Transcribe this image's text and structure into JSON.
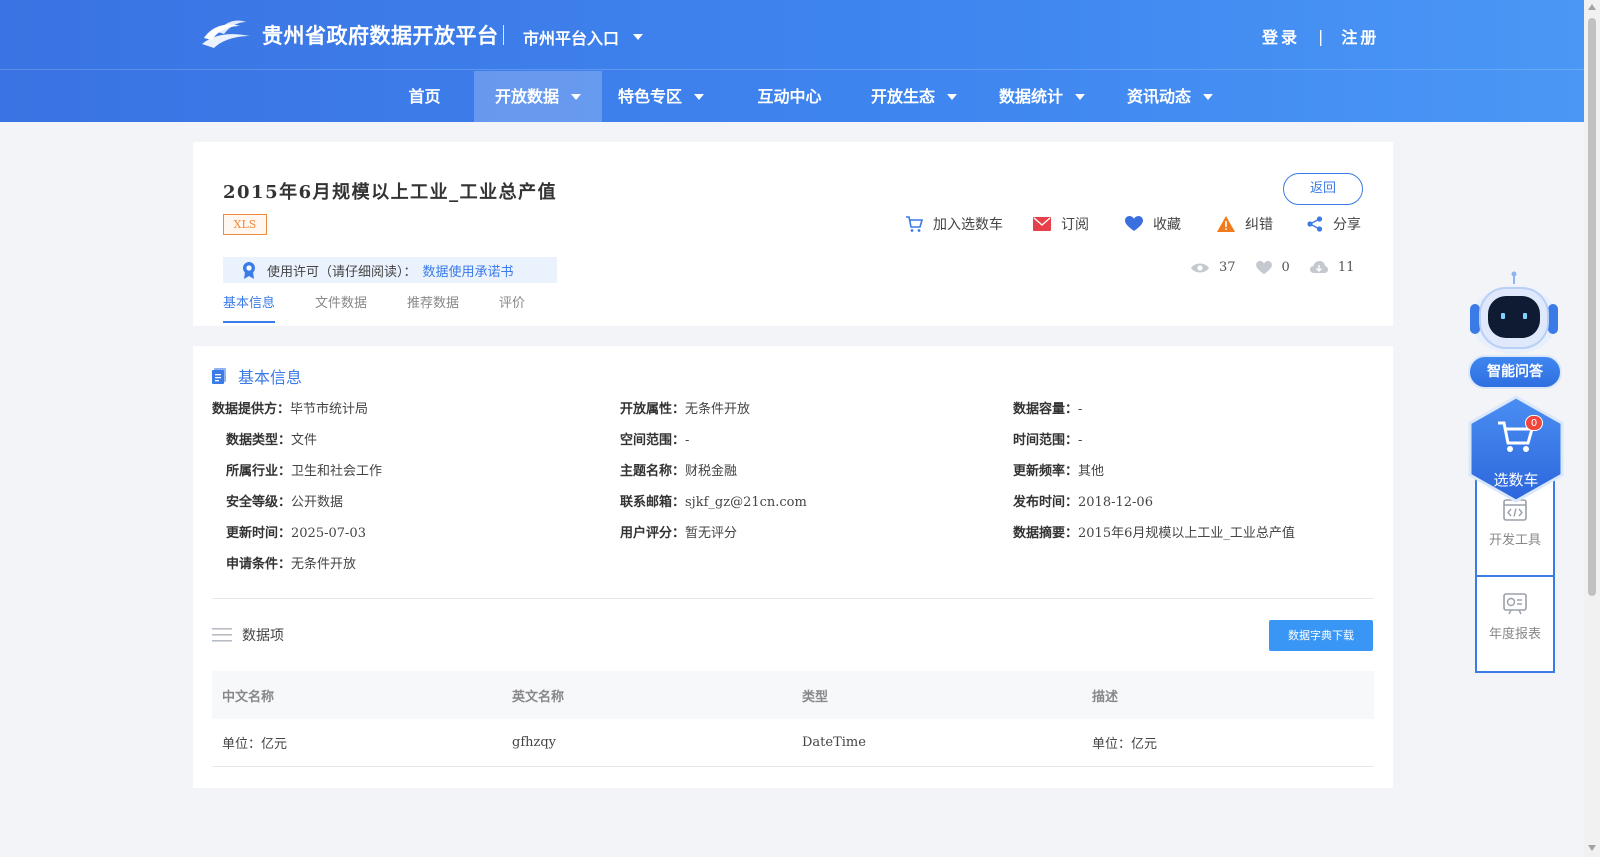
{
  "header": {
    "site_title": "贵州省政府数据开放平台",
    "city_entry": "市州平台入口",
    "login": "登录",
    "auth_sep": "|",
    "register": "注册"
  },
  "nav": {
    "items": [
      {
        "label": "首页",
        "has_dropdown": false,
        "active": false
      },
      {
        "label": "开放数据",
        "has_dropdown": true,
        "active": true
      },
      {
        "label": "特色专区",
        "has_dropdown": true,
        "active": false
      },
      {
        "label": "互动中心",
        "has_dropdown": false,
        "active": false
      },
      {
        "label": "开放生态",
        "has_dropdown": true,
        "active": false
      },
      {
        "label": "数据统计",
        "has_dropdown": true,
        "active": false
      },
      {
        "label": "资讯动态",
        "has_dropdown": true,
        "active": false
      }
    ]
  },
  "dataset": {
    "title": "2015年6月规模以上工业_工业总产值",
    "format": "XLS",
    "back_label": "返回",
    "actions": {
      "cart": "加入选数车",
      "subscribe": "订阅",
      "favorite": "收藏",
      "report": "纠错",
      "share": "分享"
    },
    "license_label": "使用许可（请仔细阅读）：",
    "license_link": "数据使用承诺书",
    "stats": {
      "views": "37",
      "likes": "0",
      "downloads": "11"
    },
    "tabs": [
      "基本信息",
      "文件数据",
      "推荐数据",
      "评价"
    ]
  },
  "basic_info": {
    "section_title": "基本信息",
    "col1": [
      {
        "label": "数据提供方：",
        "value": "毕节市统计局"
      },
      {
        "label": "数据类型：",
        "value": "文件"
      },
      {
        "label": "所属行业：",
        "value": "卫生和社会工作"
      },
      {
        "label": "安全等级：",
        "value": "公开数据"
      },
      {
        "label": "更新时间：",
        "value": "2025-07-03"
      },
      {
        "label": "申请条件：",
        "value": "无条件开放"
      }
    ],
    "col2": [
      {
        "label": "开放属性：",
        "value": "无条件开放"
      },
      {
        "label": "空间范围：",
        "value": "-"
      },
      {
        "label": "主题名称：",
        "value": "财税金融"
      },
      {
        "label": "联系邮箱：",
        "value": "sjkf_gz@21cn.com"
      },
      {
        "label": "用户评分：",
        "value": "暂无评分"
      }
    ],
    "col3": [
      {
        "label": "数据容量：",
        "value": "-"
      },
      {
        "label": "时间范围：",
        "value": "-"
      },
      {
        "label": "更新频率：",
        "value": "其他"
      },
      {
        "label": "发布时间：",
        "value": "2018-12-06"
      },
      {
        "label": "数据摘要：",
        "value": "2015年6月规模以上工业_工业总产值"
      }
    ]
  },
  "data_items": {
    "title": "数据项",
    "dict_download": "数据字典下载",
    "columns": [
      "中文名称",
      "英文名称",
      "类型",
      "描述"
    ],
    "rows": [
      [
        "单位：亿元",
        "gfhzqy",
        "DateTime",
        "单位：亿元"
      ]
    ]
  },
  "sidebar": {
    "ai_label": "智能问答",
    "cart_label": "选数车",
    "cart_count": "0",
    "dev_tools": "开发工具",
    "annual_report": "年度报表"
  },
  "colors": {
    "primary": "#3a7be8",
    "header_start": "#3a73e3",
    "header_end": "#4a97f5",
    "format_tag": "#f08a3c",
    "badge": "#f0463c"
  }
}
